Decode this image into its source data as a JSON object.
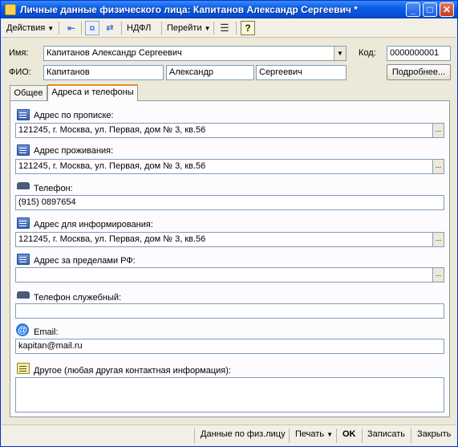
{
  "window": {
    "title": "Личные данные физического лица: Капитанов Александр Сергеевич *",
    "minimize": "_",
    "maximize": "□",
    "close": "✕"
  },
  "toolbar": {
    "actions": "Действия",
    "ndfl": "НДФЛ",
    "goto": "Перейти",
    "help": "?"
  },
  "header": {
    "name_label": "Имя:",
    "name_value": "Капитанов Александр Сергеевич",
    "code_label": "Код:",
    "code_value": "0000000001",
    "fio_label": "ФИО:",
    "last_name": "Капитанов",
    "first_name": "Александр",
    "patronymic": "Сергеевич",
    "details_button": "Подробнее..."
  },
  "tabs": [
    {
      "label": "Общее",
      "active": false
    },
    {
      "label": "Адреса и телефоны",
      "active": true
    }
  ],
  "sections": {
    "registration_address": {
      "label": "Адрес по прописке:",
      "value": "121245, г. Москва, ул. Первая, дом № 3, кв.56"
    },
    "residence_address": {
      "label": "Адрес проживания:",
      "value": "121245, г. Москва, ул. Первая, дом № 3, кв.56"
    },
    "phone": {
      "label": "Телефон:",
      "value": "(915) 0897654"
    },
    "info_address": {
      "label": "Адрес для информирования:",
      "value": "121245, г. Москва, ул. Первая, дом № 3, кв.56"
    },
    "foreign_address": {
      "label": "Адрес за пределами РФ:",
      "value": ""
    },
    "work_phone": {
      "label": "Телефон служебный:",
      "value": ""
    },
    "email": {
      "label": "Email:",
      "value": "kapitan@mail.ru"
    },
    "other": {
      "label": "Другое (любая другая контактная информация):",
      "value": ""
    }
  },
  "statusbar": {
    "person_data": "Данные по физ.лицу",
    "print": "Печать",
    "ok": "OK",
    "save": "Записать",
    "close": "Закрыть"
  },
  "colors": {
    "titlebar": "#0a5ce8",
    "window_bg": "#ece9d8",
    "active_tab_accent": "#e68b2c"
  }
}
